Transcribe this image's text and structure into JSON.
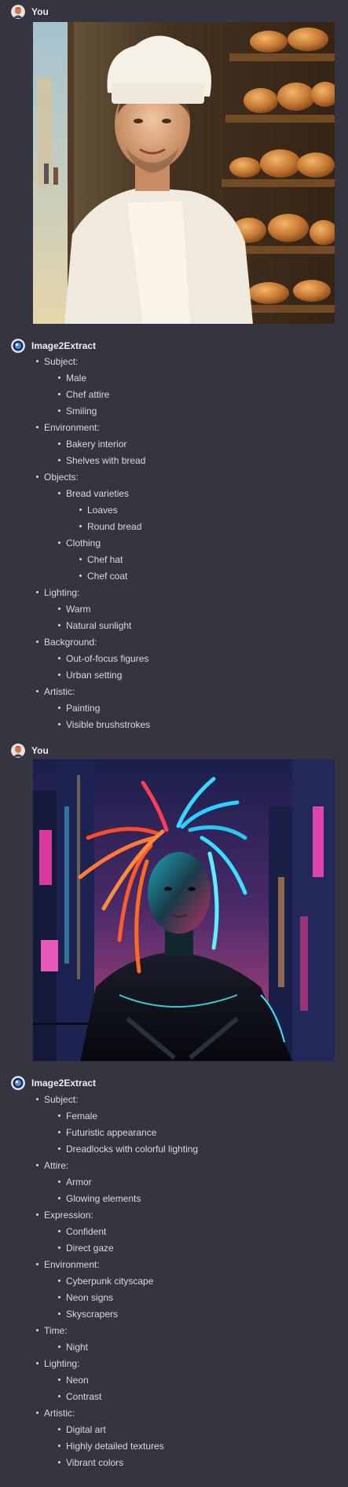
{
  "messages": [
    {
      "author": "You",
      "type": "image",
      "image_desc": "chef-portrait"
    },
    {
      "author": "Image2Extract",
      "type": "list",
      "items": [
        {
          "level": 1,
          "text": "Subject:"
        },
        {
          "level": 2,
          "text": "Male"
        },
        {
          "level": 2,
          "text": "Chef attire"
        },
        {
          "level": 2,
          "text": "Smiling"
        },
        {
          "level": 1,
          "text": "Environment:"
        },
        {
          "level": 2,
          "text": "Bakery interior"
        },
        {
          "level": 2,
          "text": "Shelves with bread"
        },
        {
          "level": 1,
          "text": "Objects:"
        },
        {
          "level": 2,
          "text": "Bread varieties"
        },
        {
          "level": 3,
          "text": "Loaves"
        },
        {
          "level": 3,
          "text": "Round bread"
        },
        {
          "level": 2,
          "text": "Clothing"
        },
        {
          "level": 3,
          "text": "Chef hat"
        },
        {
          "level": 3,
          "text": "Chef coat"
        },
        {
          "level": 1,
          "text": "Lighting:"
        },
        {
          "level": 2,
          "text": "Warm"
        },
        {
          "level": 2,
          "text": "Natural sunlight"
        },
        {
          "level": 1,
          "text": "Background:"
        },
        {
          "level": 2,
          "text": "Out-of-focus figures"
        },
        {
          "level": 2,
          "text": "Urban setting"
        },
        {
          "level": 1,
          "text": "Artistic:"
        },
        {
          "level": 2,
          "text": "Painting"
        },
        {
          "level": 2,
          "text": "Visible brushstrokes"
        }
      ]
    },
    {
      "author": "You",
      "type": "image",
      "image_desc": "cyberpunk-portrait"
    },
    {
      "author": "Image2Extract",
      "type": "list",
      "items": [
        {
          "level": 1,
          "text": "Subject:"
        },
        {
          "level": 2,
          "text": "Female"
        },
        {
          "level": 2,
          "text": "Futuristic appearance"
        },
        {
          "level": 2,
          "text": "Dreadlocks with colorful lighting"
        },
        {
          "level": 1,
          "text": "Attire:"
        },
        {
          "level": 2,
          "text": "Armor"
        },
        {
          "level": 2,
          "text": "Glowing elements"
        },
        {
          "level": 1,
          "text": "Expression:"
        },
        {
          "level": 2,
          "text": "Confident"
        },
        {
          "level": 2,
          "text": "Direct gaze"
        },
        {
          "level": 1,
          "text": "Environment:"
        },
        {
          "level": 2,
          "text": "Cyberpunk cityscape"
        },
        {
          "level": 2,
          "text": "Neon signs"
        },
        {
          "level": 2,
          "text": "Skyscrapers"
        },
        {
          "level": 1,
          "text": "Time:"
        },
        {
          "level": 2,
          "text": "Night"
        },
        {
          "level": 1,
          "text": "Lighting:"
        },
        {
          "level": 2,
          "text": "Neon"
        },
        {
          "level": 2,
          "text": "Contrast"
        },
        {
          "level": 1,
          "text": "Artistic:"
        },
        {
          "level": 2,
          "text": "Digital art"
        },
        {
          "level": 2,
          "text": "Highly detailed textures"
        },
        {
          "level": 2,
          "text": "Vibrant colors"
        }
      ]
    }
  ]
}
